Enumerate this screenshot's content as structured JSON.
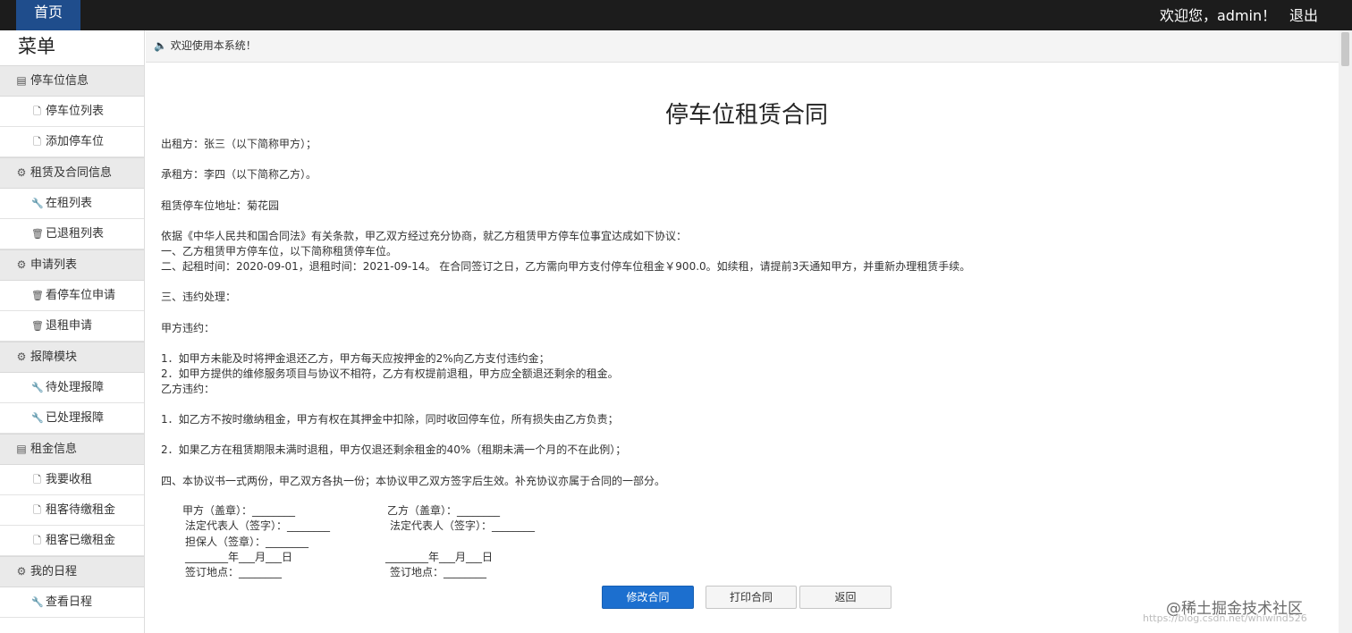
{
  "header": {
    "home_tab": "首页",
    "welcome": "欢迎您，admin！",
    "logout": "退出"
  },
  "sidebar": {
    "title": "菜单",
    "groups": [
      {
        "label": "停车位信息",
        "icon": "table-icon",
        "items": [
          {
            "label": "停车位列表",
            "icon": "file-icon"
          },
          {
            "label": "添加停车位",
            "icon": "file-icon"
          }
        ]
      },
      {
        "label": "租赁及合同信息",
        "icon": "gear-icon",
        "items": [
          {
            "label": "在租列表",
            "icon": "wrench-icon"
          },
          {
            "label": "已退租列表",
            "icon": "trash-icon"
          }
        ]
      },
      {
        "label": "申请列表",
        "icon": "gear-icon",
        "items": [
          {
            "label": "看停车位申请",
            "icon": "trash-icon"
          },
          {
            "label": "退租申请",
            "icon": "trash-icon"
          }
        ]
      },
      {
        "label": "报障模块",
        "icon": "gear-icon",
        "items": [
          {
            "label": "待处理报障",
            "icon": "wrench-icon"
          },
          {
            "label": "已处理报障",
            "icon": "wrench-icon"
          }
        ]
      },
      {
        "label": "租金信息",
        "icon": "table-icon",
        "items": [
          {
            "label": "我要收租",
            "icon": "file-icon"
          },
          {
            "label": "租客待缴租金",
            "icon": "file-icon"
          },
          {
            "label": "租客已缴租金",
            "icon": "file-icon"
          }
        ]
      },
      {
        "label": "我的日程",
        "icon": "gear-icon",
        "items": [
          {
            "label": "查看日程",
            "icon": "wrench-icon"
          }
        ]
      }
    ]
  },
  "notice": {
    "icon": "speaker-icon",
    "text": "欢迎使用本系统！"
  },
  "contract": {
    "title": "停车位租赁合同",
    "lessor": "出租方：张三（以下简称甲方）；",
    "lessee": "承租方：李四（以下简称乙方）。",
    "address": "租赁停车位地址：菊花园",
    "intro": "依据《中华人民共和国合同法》有关条款，甲乙双方经过充分协商，就乙方租赁甲方停车位事宜达成如下协议：",
    "clause1": "一、乙方租赁甲方停车位，以下简称租赁停车位。",
    "clause2": "二、起租时间：2020-09-01，退租时间：2021-09-14。 在合同签订之日，乙方需向甲方支付停车位租金￥900.0。如续租，请提前3天通知甲方，并重新办理租赁手续。",
    "clause3": "三、违约处理：",
    "party_a_breach": "甲方违约：",
    "a1": "1．如甲方未能及时将押金退还乙方，甲方每天应按押金的2%向乙方支付违约金；",
    "a2": "2．如甲方提供的维修服务项目与协议不相符，乙方有权提前退租，甲方应全额退还剩余的租金。",
    "party_b_breach": "乙方违约：",
    "b1": "1．如乙方不按时缴纳租金，甲方有权在其押金中扣除，同时收回停车位，所有损失由乙方负责；",
    "b2": "2．如果乙方在租赁期限未满时退租，甲方仅退还剩余租金的40%（租期未满一个月的不在此例）；",
    "clause4": "四、本协议书一式两份，甲乙双方各执一份；本协议甲乙双方签字后生效。补充协议亦属于合同的一部分。",
    "sign_left": {
      "seal": "甲方（盖章）：________",
      "rep": "法定代表人（签字）：________",
      "guarantor": "担保人（签章）：________",
      "date": "________年___月___日",
      "place": "签订地点：________"
    },
    "sign_right": {
      "seal": "乙方（盖章）：________",
      "rep": "法定代表人（签字）：________",
      "date": "________年___月___日",
      "place": "签订地点：________"
    }
  },
  "buttons": {
    "edit": "修改合同",
    "print": "打印合同",
    "back": "返回"
  },
  "watermark": {
    "main": "@稀土掘金技术社区",
    "url": "https://blog.csdn.net/whiwind526"
  },
  "colors": {
    "topbar": "#1c1c1c",
    "home_tab": "#1f4d8c",
    "primary_button": "#1c6fcf",
    "sidebar_group": "#eaeaea"
  }
}
